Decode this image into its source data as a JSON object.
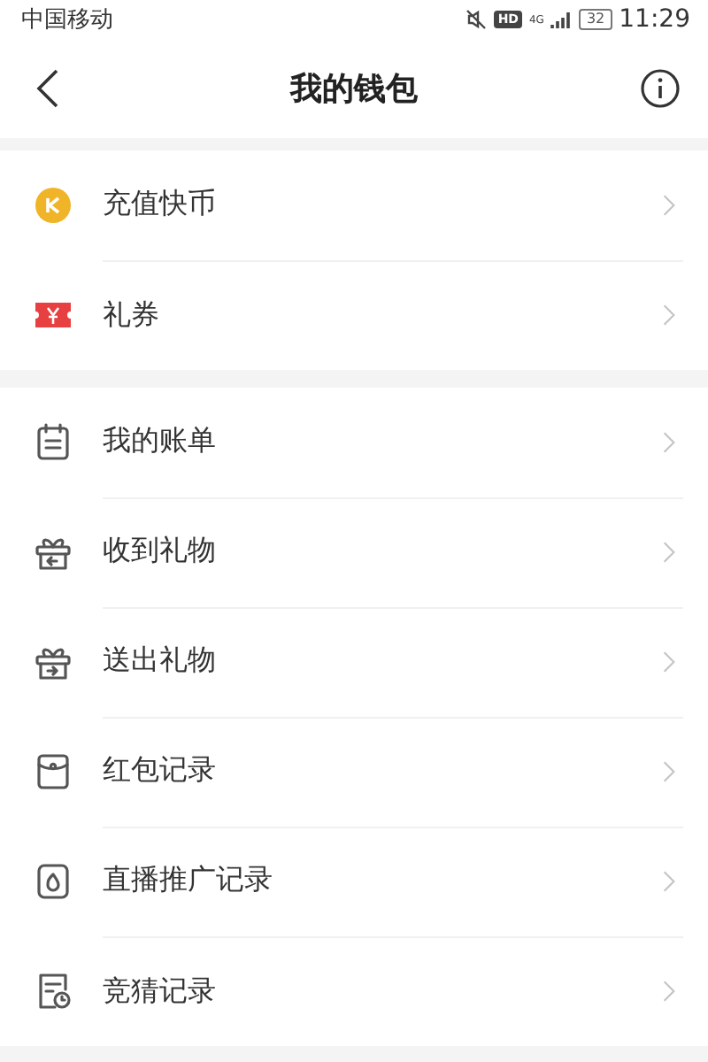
{
  "status_bar": {
    "carrier": "中国移动",
    "hd": "HD",
    "network": "4G",
    "battery": "32",
    "time": "11:29"
  },
  "nav": {
    "title": "我的钱包"
  },
  "sections": [
    {
      "items": [
        {
          "kind": "coin",
          "label": "充值快币"
        },
        {
          "kind": "ticket",
          "label": "礼券"
        }
      ]
    },
    {
      "items": [
        {
          "kind": "bill",
          "label": "我的账单"
        },
        {
          "kind": "gift_in",
          "label": "收到礼物"
        },
        {
          "kind": "gift_out",
          "label": "送出礼物"
        },
        {
          "kind": "packet",
          "label": "红包记录"
        },
        {
          "kind": "live",
          "label": "直播推广记录"
        },
        {
          "kind": "guess",
          "label": "竞猜记录"
        }
      ]
    }
  ]
}
